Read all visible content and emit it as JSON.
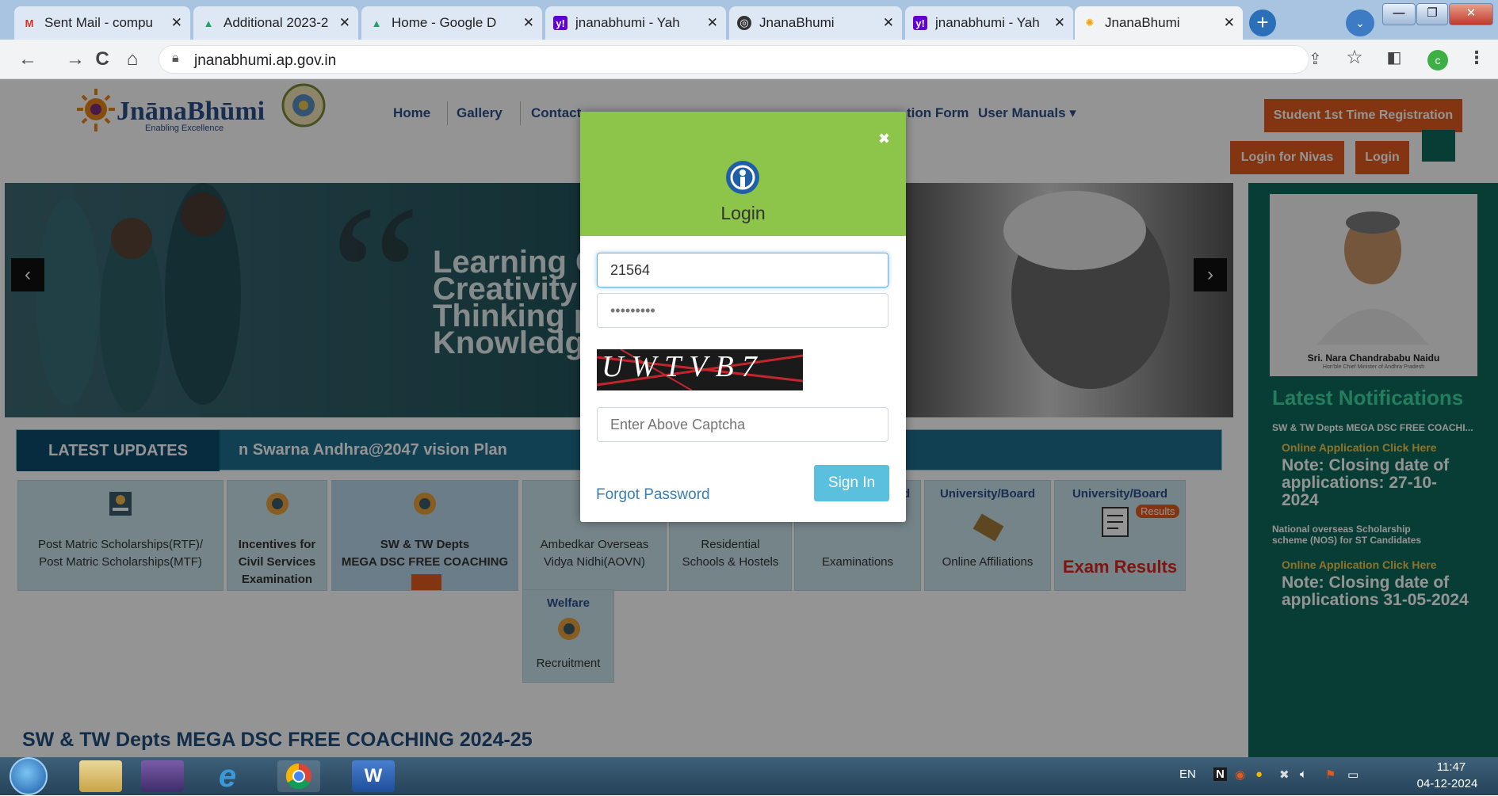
{
  "browser": {
    "tabs": [
      {
        "title": "Sent Mail - compu",
        "icon": "gmail-icon",
        "active": false
      },
      {
        "title": "Additional 2023-2",
        "icon": "google-drive-icon",
        "active": false
      },
      {
        "title": "Home - Google D",
        "icon": "google-drive-icon",
        "active": false
      },
      {
        "title": "jnanabhumi - Yah",
        "icon": "yahoo-icon",
        "active": false
      },
      {
        "title": "JnanaBhumi",
        "icon": "globe-icon",
        "active": false
      },
      {
        "title": "jnanabhumi - Yah",
        "icon": "yahoo-icon",
        "active": false
      },
      {
        "title": "JnanaBhumi",
        "icon": "jnanabhumi-icon",
        "active": true
      }
    ],
    "url": "jnanabhumi.ap.gov.in",
    "profile_initial": "c"
  },
  "site": {
    "logo_name": "JnānaBhūmi",
    "logo_tagline": "Enabling Excellence",
    "nav": [
      "Home",
      "Gallery",
      "Contact",
      "tion Form",
      "User Manuals ▾"
    ],
    "student_registration": "Student 1st Time Registration",
    "login_nivas": "Login for Nivas",
    "login": "Login"
  },
  "hero": {
    "lines": [
      "Learning G",
      "Creativity L",
      "Thinking p",
      "Knowledge"
    ],
    "prev": "‹",
    "next": "›"
  },
  "updates": {
    "label": "LATEST UPDATES",
    "ticker": "n Swarna Andhra@2047 vision Plan"
  },
  "tiles": [
    {
      "label1": "Post Matric Scholarships(RTF)/",
      "label2": "Post Matric Scholarships(MTF)",
      "label3": ""
    },
    {
      "label1": "Incentives for",
      "label2": "Civil Services",
      "label3": "Examination"
    },
    {
      "label1": "SW & TW Depts",
      "label2": "MEGA DSC FREE COACHING",
      "label3": ""
    },
    {
      "label1": "Ambedkar Overseas",
      "label2": "Vidya Nidhi(AOVN)",
      "label3": ""
    },
    {
      "label1": "Residential",
      "label2": "Schools & Hostels",
      "label3": ""
    },
    {
      "head": "d",
      "label1": "Examinations",
      "label2": "",
      "label3": ""
    },
    {
      "head": "University/Board",
      "label1": "Online Affiliations",
      "label2": "",
      "label3": ""
    },
    {
      "head": "University/Board",
      "badge": "Results",
      "label1": "Exam Results",
      "label2": "",
      "label3": ""
    },
    {
      "head": "Welfare",
      "label1": "Recruitment",
      "label2": "",
      "label3": ""
    }
  ],
  "sidebar": {
    "cm_name": "Sri. Nara Chandrababu Naidu",
    "cm_title": "Hon'ble Chief Minister of Andhra Pradesh",
    "notifications_title": "Latest Notifications",
    "items": [
      {
        "heading": "SW & TW Depts MEGA DSC FREE COACHI...",
        "link": "Online Application Click Here",
        "note": "Note: Closing date of applications: 27-10-2024"
      },
      {
        "heading": "National overseas Scholarship scheme (NOS) for ST Candidates",
        "link": "Online Application Click Here",
        "note": "Note: Closing date of applications 31-05-2024"
      }
    ]
  },
  "section_title": "SW & TW Depts MEGA DSC FREE COACHING 2024-25",
  "modal": {
    "close": "✖",
    "title": "Login",
    "username_value": "21564",
    "password_value": "•••••••••",
    "captcha_text": "UWTVB7",
    "captcha_placeholder": "Enter Above Captcha",
    "forgot": "Forgot Password",
    "signin": "Sign In"
  },
  "taskbar": {
    "lang": "EN",
    "time": "11:47",
    "date": "04-12-2024"
  },
  "colors": {
    "modal_header": "#8dc44a",
    "signin": "#5bc0de",
    "orange_button": "#e25a1c",
    "sidebar": "#0f6a5e"
  }
}
